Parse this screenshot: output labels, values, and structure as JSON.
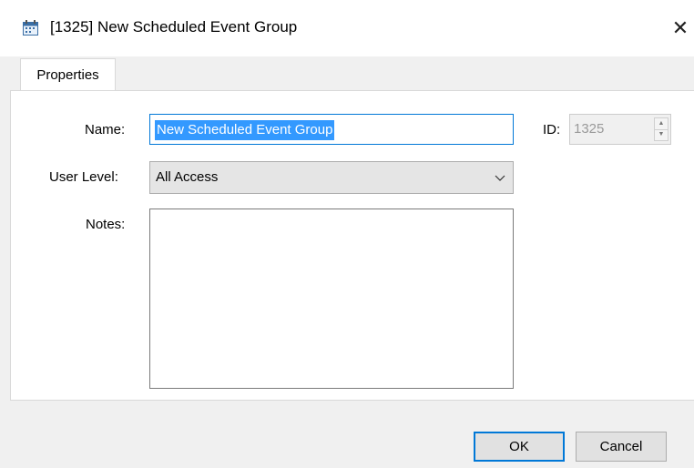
{
  "window": {
    "title": "[1325] New Scheduled Event Group",
    "close_label": "✕"
  },
  "tabs": [
    {
      "label": "Properties",
      "active": true
    }
  ],
  "form": {
    "name_label": "Name:",
    "name_value": "New Scheduled Event Group",
    "id_label": "ID:",
    "id_value": "1325",
    "user_level_label": "User Level:",
    "user_level_value": "All Access",
    "notes_label": "Notes:",
    "notes_value": ""
  },
  "buttons": {
    "ok": "OK",
    "cancel": "Cancel"
  },
  "colors": {
    "accent": "#0078d7",
    "selection": "#3399ff",
    "panel": "#ffffff",
    "background": "#f0f0f0"
  },
  "icons": {
    "title": "calendar-icon",
    "dropdown": "chevron-down-icon",
    "spin_up": "spin-up-icon",
    "spin_down": "spin-down-icon"
  }
}
